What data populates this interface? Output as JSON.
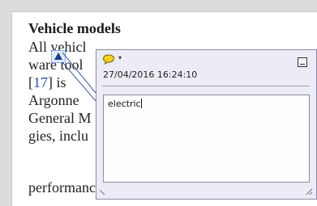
{
  "document": {
    "heading": "Vehicle models",
    "lines": [
      {
        "text": "All vehicl"
      },
      {
        "text": "ware tool"
      },
      {
        "pre": "[",
        "ref": "17",
        "post": "]  is  "
      },
      {
        "text": "Argonne"
      },
      {
        "text": "General M"
      },
      {
        "text": "gies, inclu"
      },
      {
        "text": "performance of particular ICEV and BE"
      }
    ]
  },
  "annotation": {
    "timestamp": "27/04/2016 16:24:10",
    "menu_caret": "▾",
    "comment_text": "electric"
  },
  "colors": {
    "accent": "#e8b800",
    "link": "#2255aa",
    "popup_bg": "#ececf6"
  }
}
